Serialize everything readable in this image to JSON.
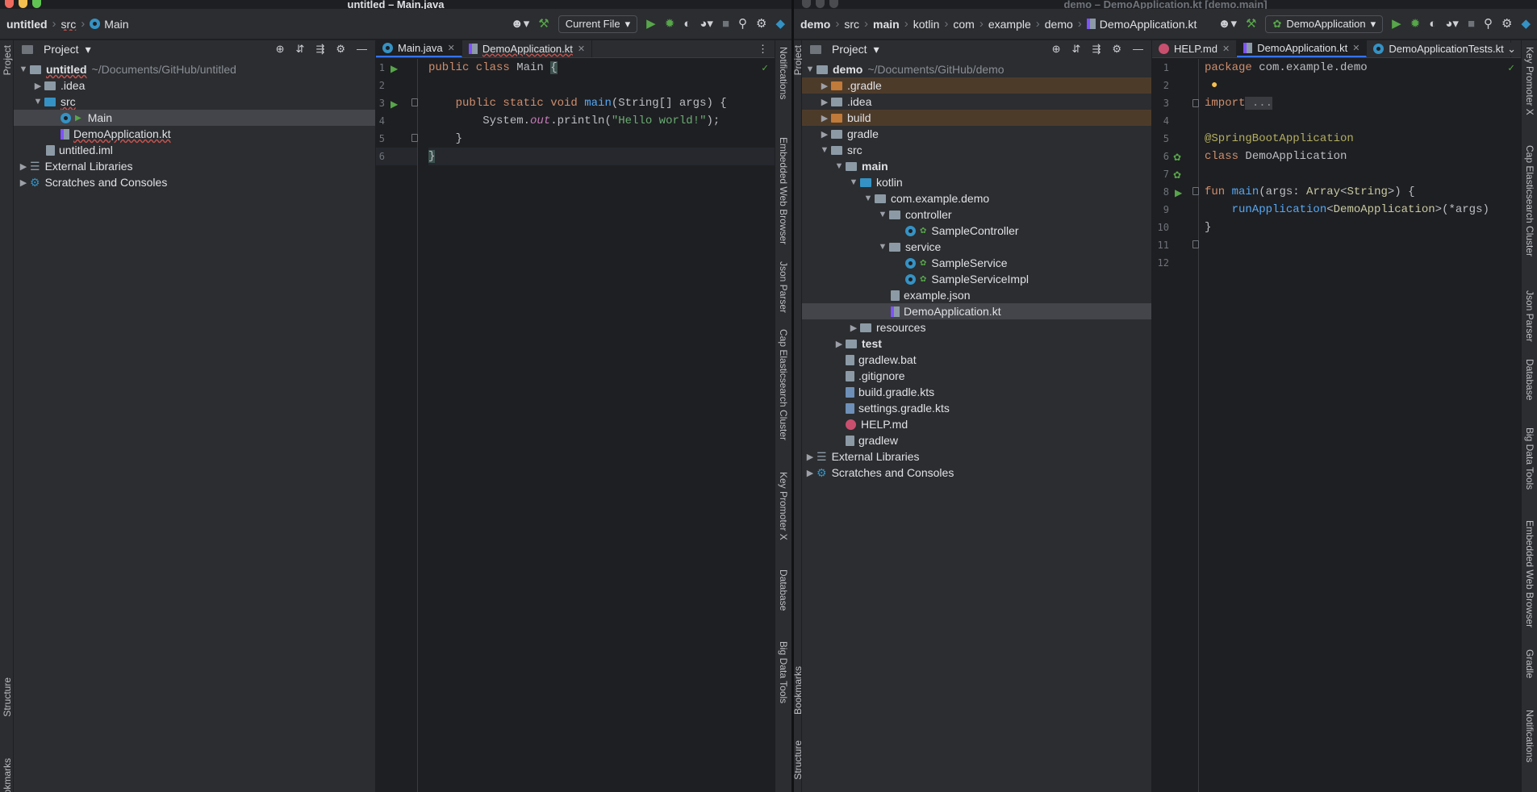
{
  "left": {
    "title": "untitled – Main.java",
    "crumbs": [
      "untitled",
      "src",
      "Main"
    ],
    "run_config": "Current File",
    "project_label": "Project",
    "tree": [
      {
        "label": "untitled",
        "extra": "~/Documents/GitHub/untitled",
        "icon": "folder-icon"
      },
      {
        "label": ".idea",
        "icon": "folder-icon"
      },
      {
        "label": "src",
        "icon": "source-folder-icon"
      },
      {
        "label": "Main",
        "icon": "java-class-icon"
      },
      {
        "label": "DemoApplication.kt",
        "icon": "kotlin-file-icon"
      },
      {
        "label": "untitled.iml",
        "icon": "iml-file-icon"
      },
      {
        "label": "External Libraries",
        "icon": "libraries-icon"
      },
      {
        "label": "Scratches and Consoles",
        "icon": "scratches-icon"
      }
    ],
    "tabs": [
      "Main.java",
      "DemoApplication.kt"
    ],
    "line_numbers": [
      "1",
      "2",
      "3",
      "4",
      "5",
      "6"
    ],
    "code": [
      "public class Main {",
      "",
      "    public static void main(String[] args) {",
      "        System.out.println(\"Hello world!\");",
      "    }",
      "}"
    ],
    "strip_left": [
      "Project",
      "Structure",
      "Bookmarks"
    ],
    "strip_right": [
      "Notifications",
      "Embedded Web Browser",
      "Json Parser",
      "Cap Elasticsearch Cluster",
      "Key Promoter X",
      "Database",
      "Big Data Tools"
    ]
  },
  "right": {
    "title": "demo – DemoApplication.kt [demo.main]",
    "crumbs": [
      "demo",
      "src",
      "main",
      "kotlin",
      "com",
      "example",
      "demo",
      "DemoApplication.kt"
    ],
    "run_config": "DemoApplication",
    "project_label": "Project",
    "tree": [
      {
        "label": "demo",
        "extra": "~/Documents/GitHub/demo"
      },
      {
        "label": ".gradle"
      },
      {
        "label": ".idea"
      },
      {
        "label": "build"
      },
      {
        "label": "gradle"
      },
      {
        "label": "src"
      },
      {
        "label": "main"
      },
      {
        "label": "kotlin"
      },
      {
        "label": "com.example.demo"
      },
      {
        "label": "controller"
      },
      {
        "label": "SampleController"
      },
      {
        "label": "service"
      },
      {
        "label": "SampleService"
      },
      {
        "label": "SampleServiceImpl"
      },
      {
        "label": "example.json"
      },
      {
        "label": "DemoApplication.kt"
      },
      {
        "label": "resources"
      },
      {
        "label": "test"
      },
      {
        "label": "gradlew.bat"
      },
      {
        "label": ".gitignore"
      },
      {
        "label": "build.gradle.kts"
      },
      {
        "label": "settings.gradle.kts"
      },
      {
        "label": "HELP.md"
      },
      {
        "label": "gradlew"
      },
      {
        "label": "External Libraries"
      },
      {
        "label": "Scratches and Consoles"
      }
    ],
    "tabs": [
      "HELP.md",
      "DemoApplication.kt",
      "DemoApplicationTests.kt"
    ],
    "line_numbers": [
      "1",
      "2",
      "3",
      "4",
      "5",
      "6",
      "7",
      "8",
      "9",
      "10",
      "11",
      "12"
    ],
    "code_text": {
      "l1a": "package",
      "l1b": " com.example.demo",
      "l3a": "import",
      "l3b": " ...",
      "l6": "@SpringBootApplication",
      "l7a": "class",
      "l7b": " DemoApplication",
      "l9a": "fun",
      "l9b": " main",
      "l9c": "(args: ",
      "l9d": "Array",
      "l9e": "<",
      "l9f": "String",
      "l9g": ">) {",
      "l10a": "    runApplication",
      "l10b": "<",
      "l10c": "DemoApplication",
      "l10d": ">(*args)",
      "l11": "}"
    },
    "strip_left": [
      "Project",
      "Bookmarks",
      "Structure"
    ],
    "strip_right": [
      "Key Promoter X",
      "Cap Elasticsearch Cluster",
      "Json Parser",
      "Database",
      "Big Data Tools",
      "Embedded Web Browser",
      "Gradle",
      "Notifications"
    ]
  },
  "colors": {
    "accent": "#3574f0",
    "run": "#57a64a"
  }
}
